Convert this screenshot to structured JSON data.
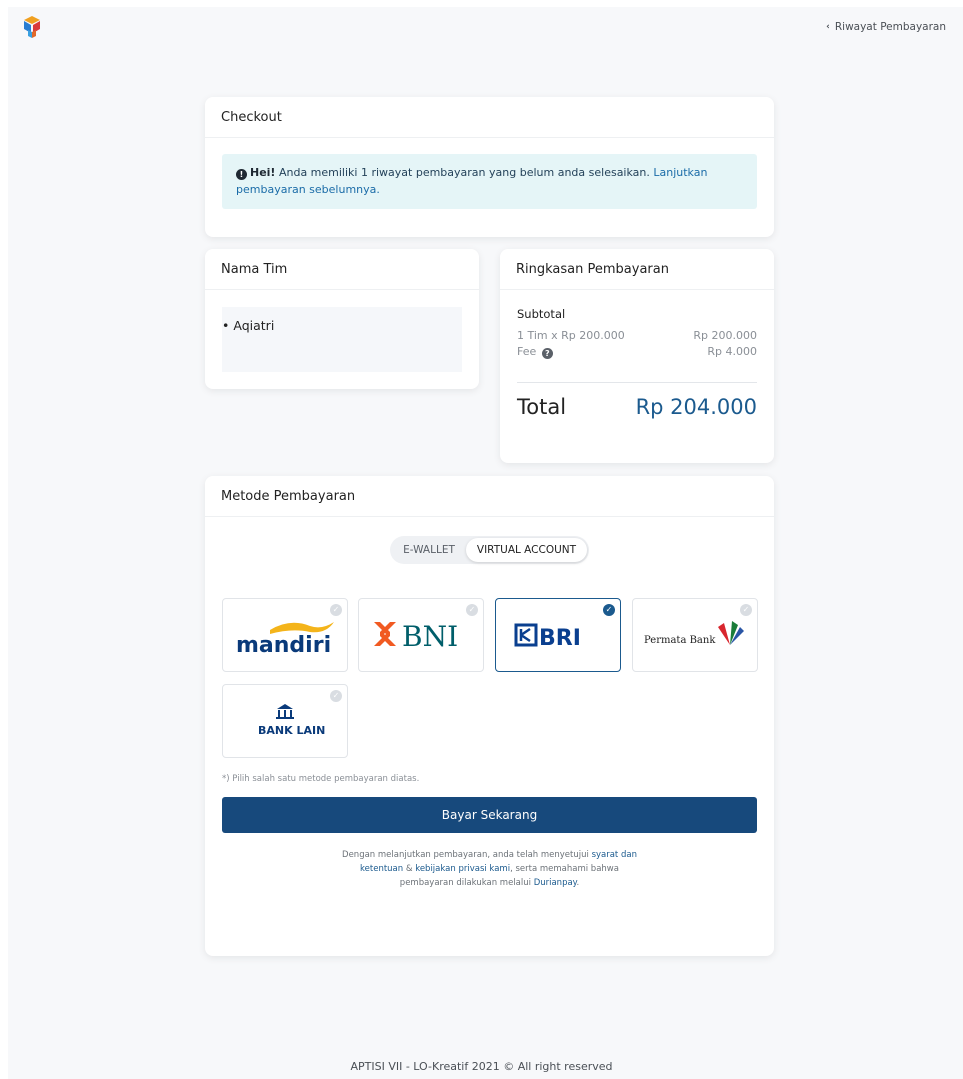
{
  "header": {
    "back_link": "Riwayat Pembayaran"
  },
  "checkout": {
    "title": "Checkout",
    "alert_bold": "Hei!",
    "alert_text": " Anda memiliki 1 riwayat pembayaran yang belum anda selesaikan. ",
    "alert_link": "Lanjutkan pembayaran sebelumnya."
  },
  "team": {
    "title": "Nama Tim",
    "members": [
      "Aqiatri"
    ]
  },
  "summary": {
    "title": "Ringkasan Pembayaran",
    "subtotal_label": "Subtotal",
    "item_label": "1 Tim x Rp 200.000",
    "item_value": "Rp 200.000",
    "fee_label": "Fee",
    "fee_value": "Rp 4.000",
    "total_label": "Total",
    "total_value": "Rp 204.000"
  },
  "payment": {
    "title": "Metode Pembayaran",
    "tabs": [
      {
        "label": "E-WALLET",
        "active": false
      },
      {
        "label": "VIRTUAL ACCOUNT",
        "active": true
      }
    ],
    "banks": [
      {
        "name": "mandiri",
        "selected": false
      },
      {
        "name": "BNI",
        "selected": false
      },
      {
        "name": "BRI",
        "selected": true
      },
      {
        "name": "Permata Bank",
        "selected": false
      },
      {
        "name": "BANK LAIN",
        "selected": false
      }
    ],
    "note": "*) Pilih salah satu metode pembayaran diatas.",
    "pay_button": "Bayar Sekarang",
    "terms_1": "Dengan melanjutkan pembayaran, anda telah menyetujui ",
    "terms_link_1": "syarat dan ketentuan",
    "terms_2": " & ",
    "terms_link_2": "kebijakan privasi kami",
    "terms_3": ", serta memahami bahwa pembayaran dilakukan melalui ",
    "terms_link_3": "Durianpay",
    "terms_4": "."
  },
  "colors": {
    "primary": "#17497c",
    "accent_text": "#1b5a8e",
    "alert_bg": "#e5f5f7"
  },
  "footer": {
    "text": "APTISI VII - LO-Kreatif 2021 © All right reserved"
  }
}
